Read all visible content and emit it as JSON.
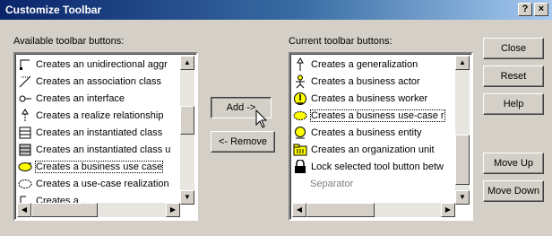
{
  "window": {
    "title": "Customize Toolbar",
    "help_glyph": "?",
    "close_glyph": "×"
  },
  "available": {
    "label": "Available toolbar buttons:",
    "items": [
      {
        "label": "Creates an unidirectional aggr",
        "icon": "unidirectional-aggregation-icon"
      },
      {
        "label": "Creates an association class",
        "icon": "association-class-icon"
      },
      {
        "label": "Creates an interface",
        "icon": "interface-icon"
      },
      {
        "label": "Creates a realize relationship",
        "icon": "realize-relationship-icon"
      },
      {
        "label": "Creates an instantiated class",
        "icon": "instantiated-class-icon"
      },
      {
        "label": "Creates an instantiated class u",
        "icon": "instantiated-class-utility-icon"
      },
      {
        "label": "Creates a business use case",
        "icon": "business-use-case-icon",
        "selected": true
      },
      {
        "label": "Creates a use-case realization",
        "icon": "use-case-realization-icon"
      },
      {
        "label": "Creates a ...",
        "icon": "partial-item-icon"
      }
    ]
  },
  "current": {
    "label": "Current toolbar buttons:",
    "items": [
      {
        "label": "Creates a generalization",
        "icon": "generalization-icon"
      },
      {
        "label": "Creates a business actor",
        "icon": "business-actor-icon"
      },
      {
        "label": "Creates a business worker",
        "icon": "business-worker-icon"
      },
      {
        "label": "Creates a business use-case r",
        "icon": "business-use-case-realization-icon",
        "selected": true
      },
      {
        "label": "Creates a business entity",
        "icon": "business-entity-icon"
      },
      {
        "label": "Creates an organization unit",
        "icon": "organization-unit-icon"
      },
      {
        "label": "Lock selected tool button betw",
        "icon": "lock-icon"
      },
      {
        "label": "Separator",
        "icon": "",
        "separator": true
      }
    ]
  },
  "buttons": {
    "add": "Add ->",
    "remove": "<- Remove",
    "close": "Close",
    "reset": "Reset",
    "help": "Help",
    "move_up": "Move Up",
    "move_down": "Move Down"
  },
  "colors": {
    "titlebar_start": "#0a246a",
    "titlebar_end": "#a6caf0",
    "face": "#d4d0c8",
    "business_yellow": "#ffff00"
  }
}
